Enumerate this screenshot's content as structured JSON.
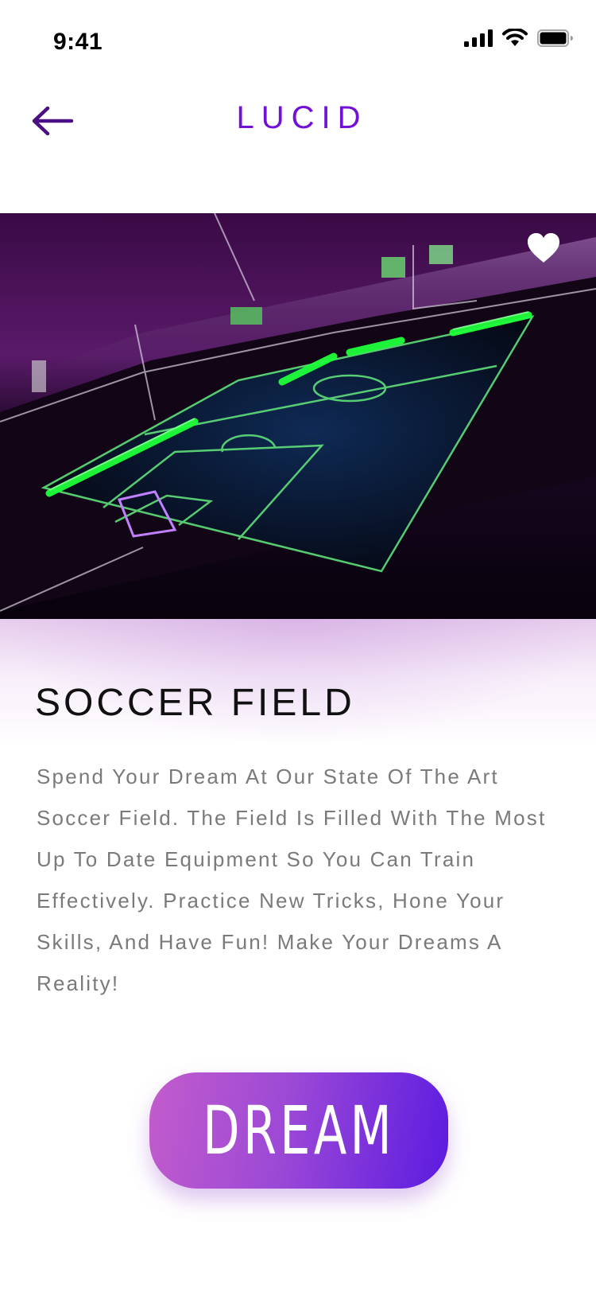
{
  "status_bar": {
    "time": "9:41",
    "icons": [
      "cellular-signal-icon",
      "wifi-icon",
      "battery-icon"
    ]
  },
  "header": {
    "back_icon": "arrow-left-icon",
    "title": "LUCID"
  },
  "hero": {
    "image_subject": "neon soccer field",
    "favorite_icon": "heart-icon",
    "favorited": true
  },
  "detail": {
    "title": "SOCCER FIELD",
    "description": "Spend Your Dream At Our State Of The Art Soccer Field. The Field Is Filled With The Most Up To Date Equipment So You Can Train Effectively. Practice New Tricks, Hone Your Skills, And Have Fun! Make Your Dreams A Reality!"
  },
  "action": {
    "label": "DREAM"
  },
  "colors": {
    "accent": "#7210d6",
    "button_start": "#c35ccc",
    "button_end": "#5b1be0",
    "text_primary": "#111111",
    "text_secondary": "#7a7a7a"
  }
}
